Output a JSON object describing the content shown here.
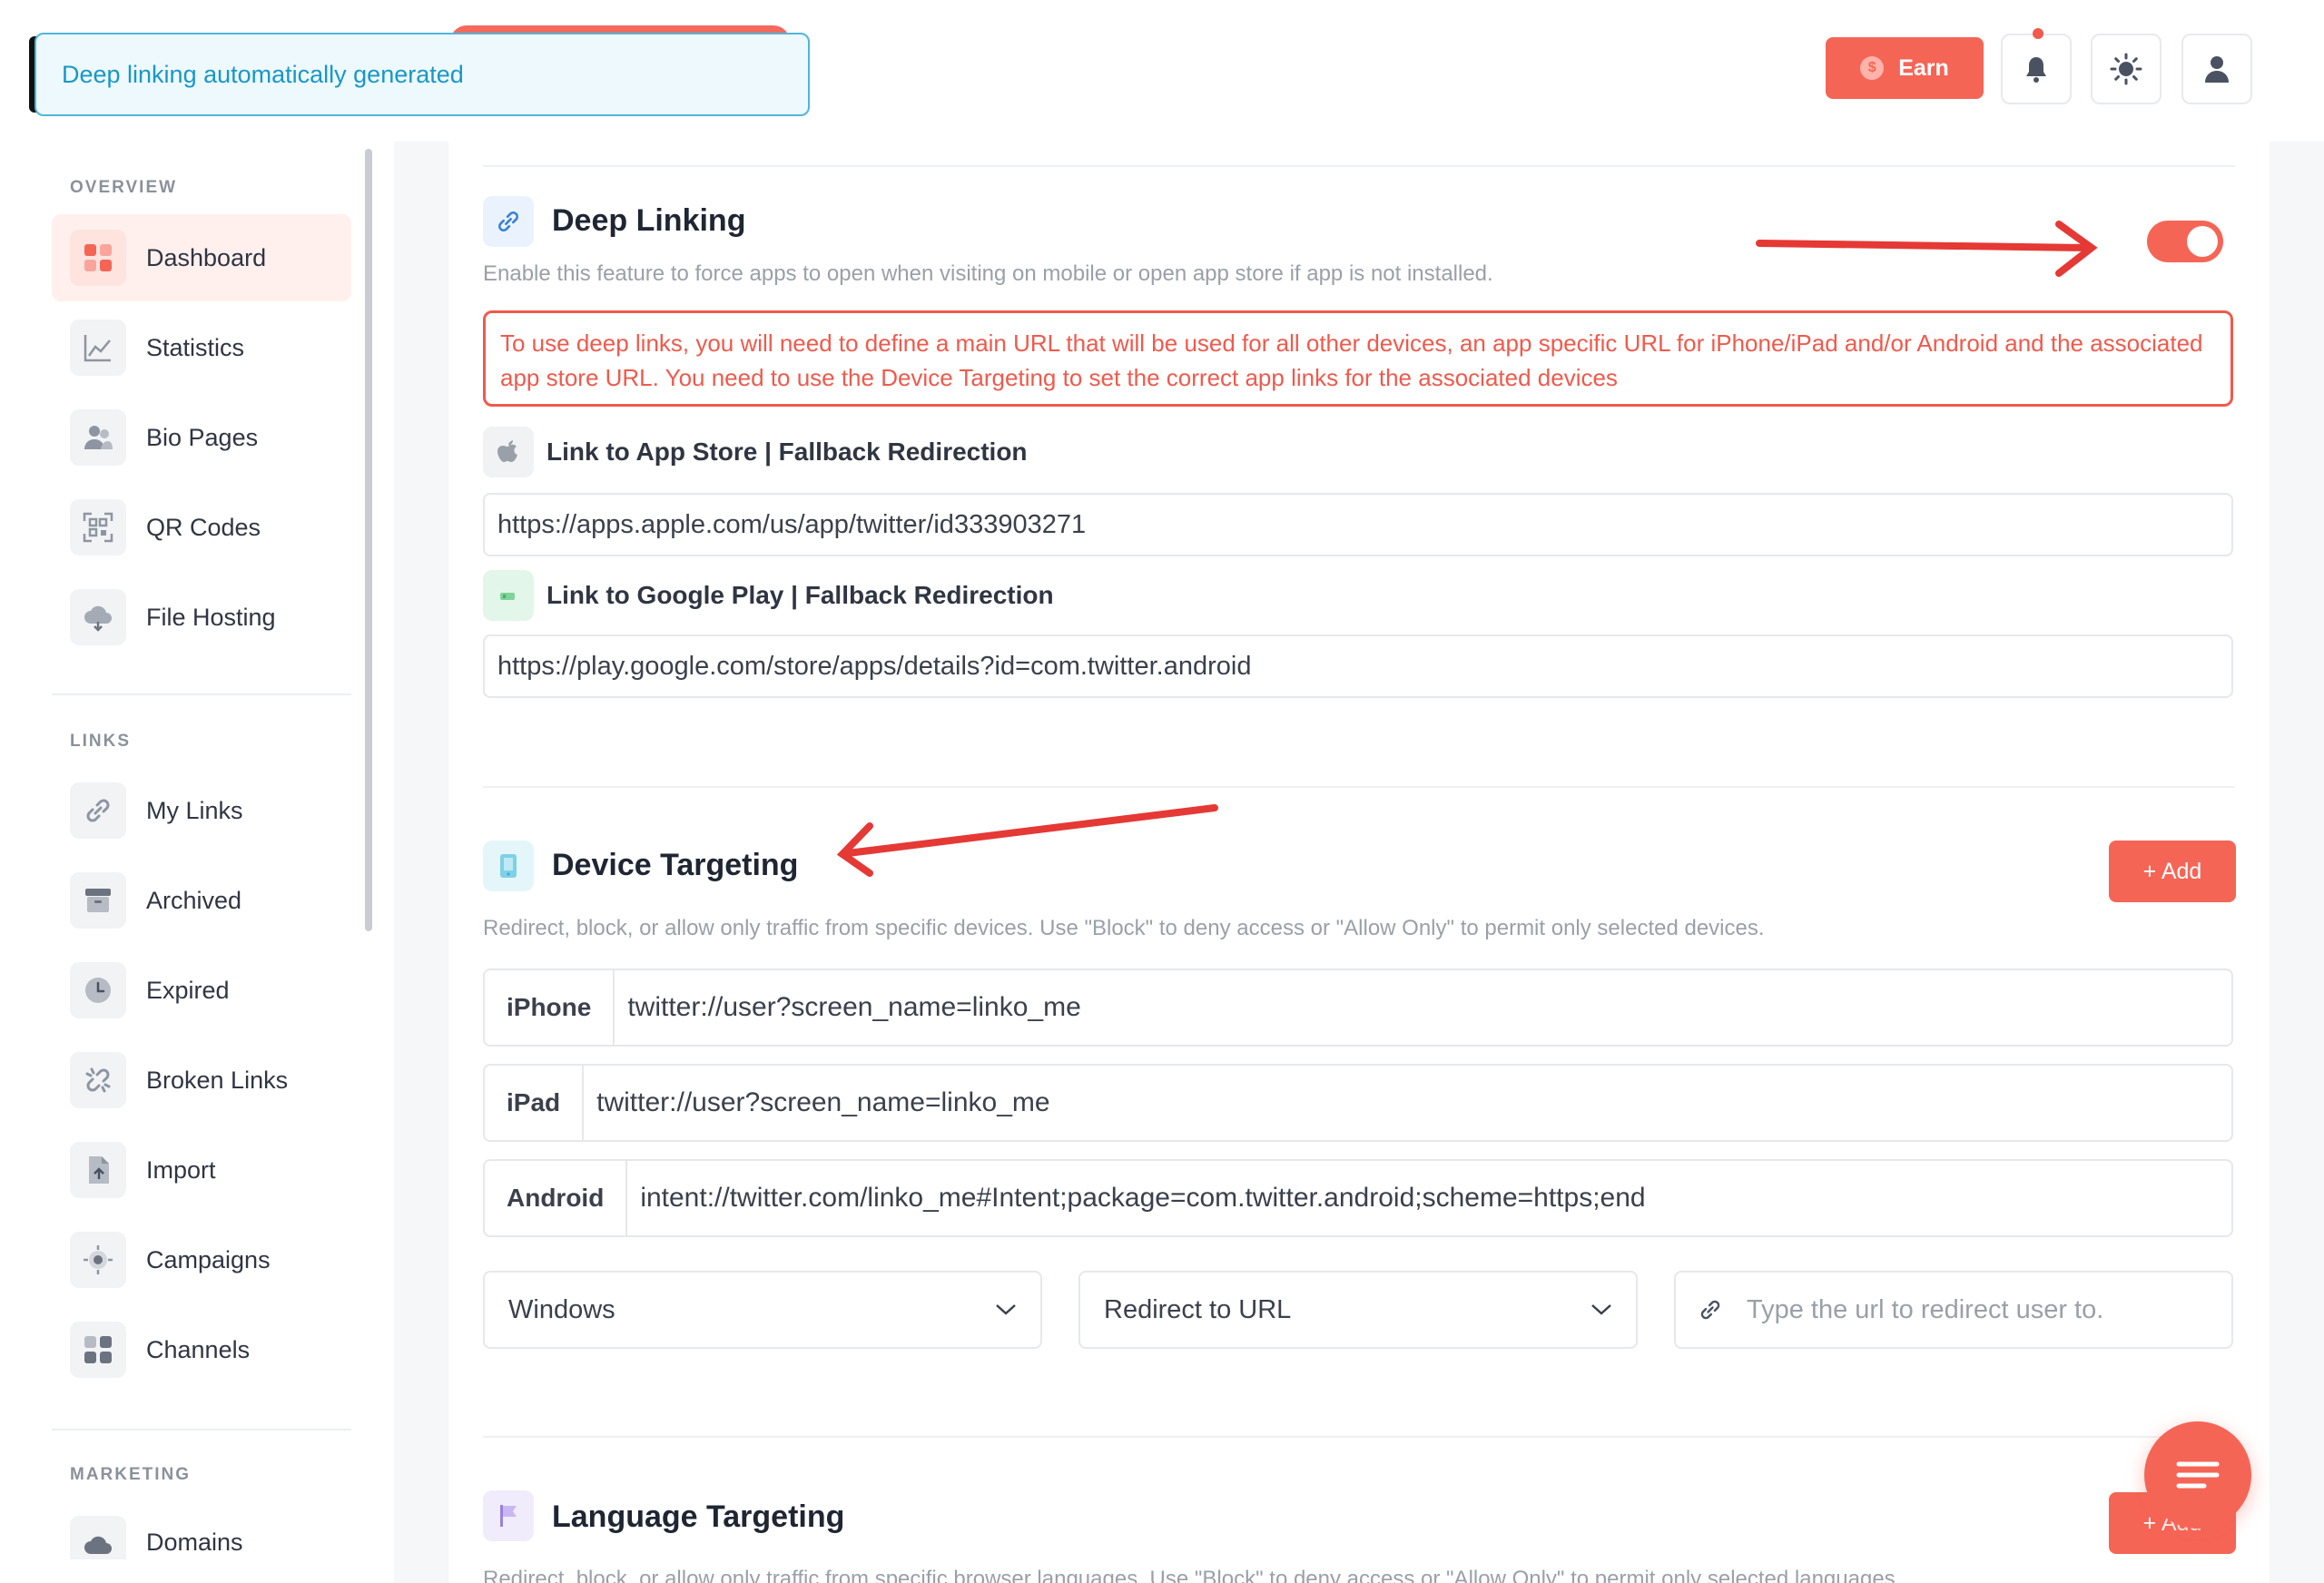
{
  "toast": {
    "text": "Deep linking automatically generated"
  },
  "header": {
    "earn_label": "Earn",
    "coin_symbol": "$"
  },
  "sidebar": {
    "overview_title": "OVERVIEW",
    "links_title": "LINKS",
    "marketing_title": "MARKETING",
    "overview_items": [
      "Dashboard",
      "Statistics",
      "Bio Pages",
      "QR Codes",
      "File Hosting"
    ],
    "links_items": [
      "My Links",
      "Archived",
      "Expired",
      "Broken Links",
      "Import",
      "Campaigns",
      "Channels"
    ],
    "marketing_items": [
      "Domains"
    ]
  },
  "deep_linking": {
    "title": "Deep Linking",
    "description": "Enable this feature to force apps to open when visiting on mobile or open app store if app is not installed.",
    "enabled": true,
    "alert": "To use deep links, you will need to define a main URL that will be used for all other devices, an app specific URL for iPhone/iPad and/or Android and the associated app store URL. You need to use the Device Targeting to set the correct app links for the associated devices",
    "app_store_label": "Link to App Store | Fallback Redirection",
    "app_store_url": "https://apps.apple.com/us/app/twitter/id333903271",
    "google_play_label": "Link to Google Play | Fallback Redirection",
    "google_play_url": "https://play.google.com/store/apps/details?id=com.twitter.android"
  },
  "device_targeting": {
    "title": "Device Targeting",
    "description": "Redirect, block, or allow only traffic from specific devices. Use \"Block\" to deny access or \"Allow Only\" to permit only selected devices.",
    "add_label": "+ Add",
    "rows": [
      {
        "device": "iPhone",
        "value": "twitter://user?screen_name=linko_me"
      },
      {
        "device": "iPad",
        "value": "twitter://user?screen_name=linko_me"
      },
      {
        "device": "Android",
        "value": "intent://twitter.com/linko_me#Intent;package=com.twitter.android;scheme=https;end"
      }
    ],
    "new_row": {
      "device_select": "Windows",
      "action_select": "Redirect to URL",
      "url_placeholder": "Type the url to redirect user to."
    }
  },
  "language_targeting": {
    "title": "Language Targeting",
    "description": "Redirect, block, or allow only traffic from specific browser languages. Use \"Block\" to deny access or \"Allow Only\" to permit only selected languages.",
    "add_label": "+ Add"
  },
  "colors": {
    "accent": "#f56556",
    "info": "#1897c8",
    "alert": "#ef5a4c",
    "annotation_arrow": "#e53935"
  }
}
